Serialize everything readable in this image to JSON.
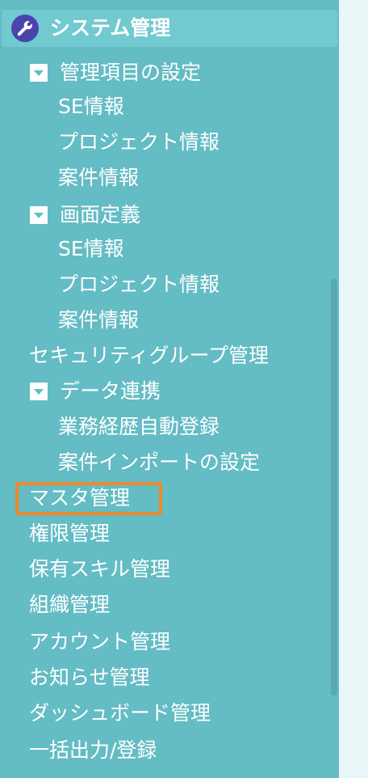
{
  "header": {
    "title": "システム管理",
    "icon": "wrench-icon"
  },
  "menu": {
    "item_setting_group": "管理項目の設定",
    "item_setting_se": "SE情報",
    "item_setting_project": "プロジェクト情報",
    "item_setting_case": "案件情報",
    "screen_def_group": "画面定義",
    "screen_def_se": "SE情報",
    "screen_def_project": "プロジェクト情報",
    "screen_def_case": "案件情報",
    "security_group": "セキュリティグループ管理",
    "data_link_group": "データ連携",
    "data_link_career": "業務経歴自動登録",
    "data_link_import": "案件インポートの設定",
    "master": "マスタ管理",
    "permission": "権限管理",
    "skill": "保有スキル管理",
    "organization": "組織管理",
    "account": "アカウント管理",
    "notice": "お知らせ管理",
    "dashboard": "ダッシュボード管理",
    "bulk": "一括出力/登録"
  },
  "colors": {
    "sidebar_bg": "#64bcc4",
    "header_bg": "#72c9cf",
    "badge": "#4a44ad",
    "highlight": "#f0882c",
    "page_bg": "#e8f6f7"
  }
}
